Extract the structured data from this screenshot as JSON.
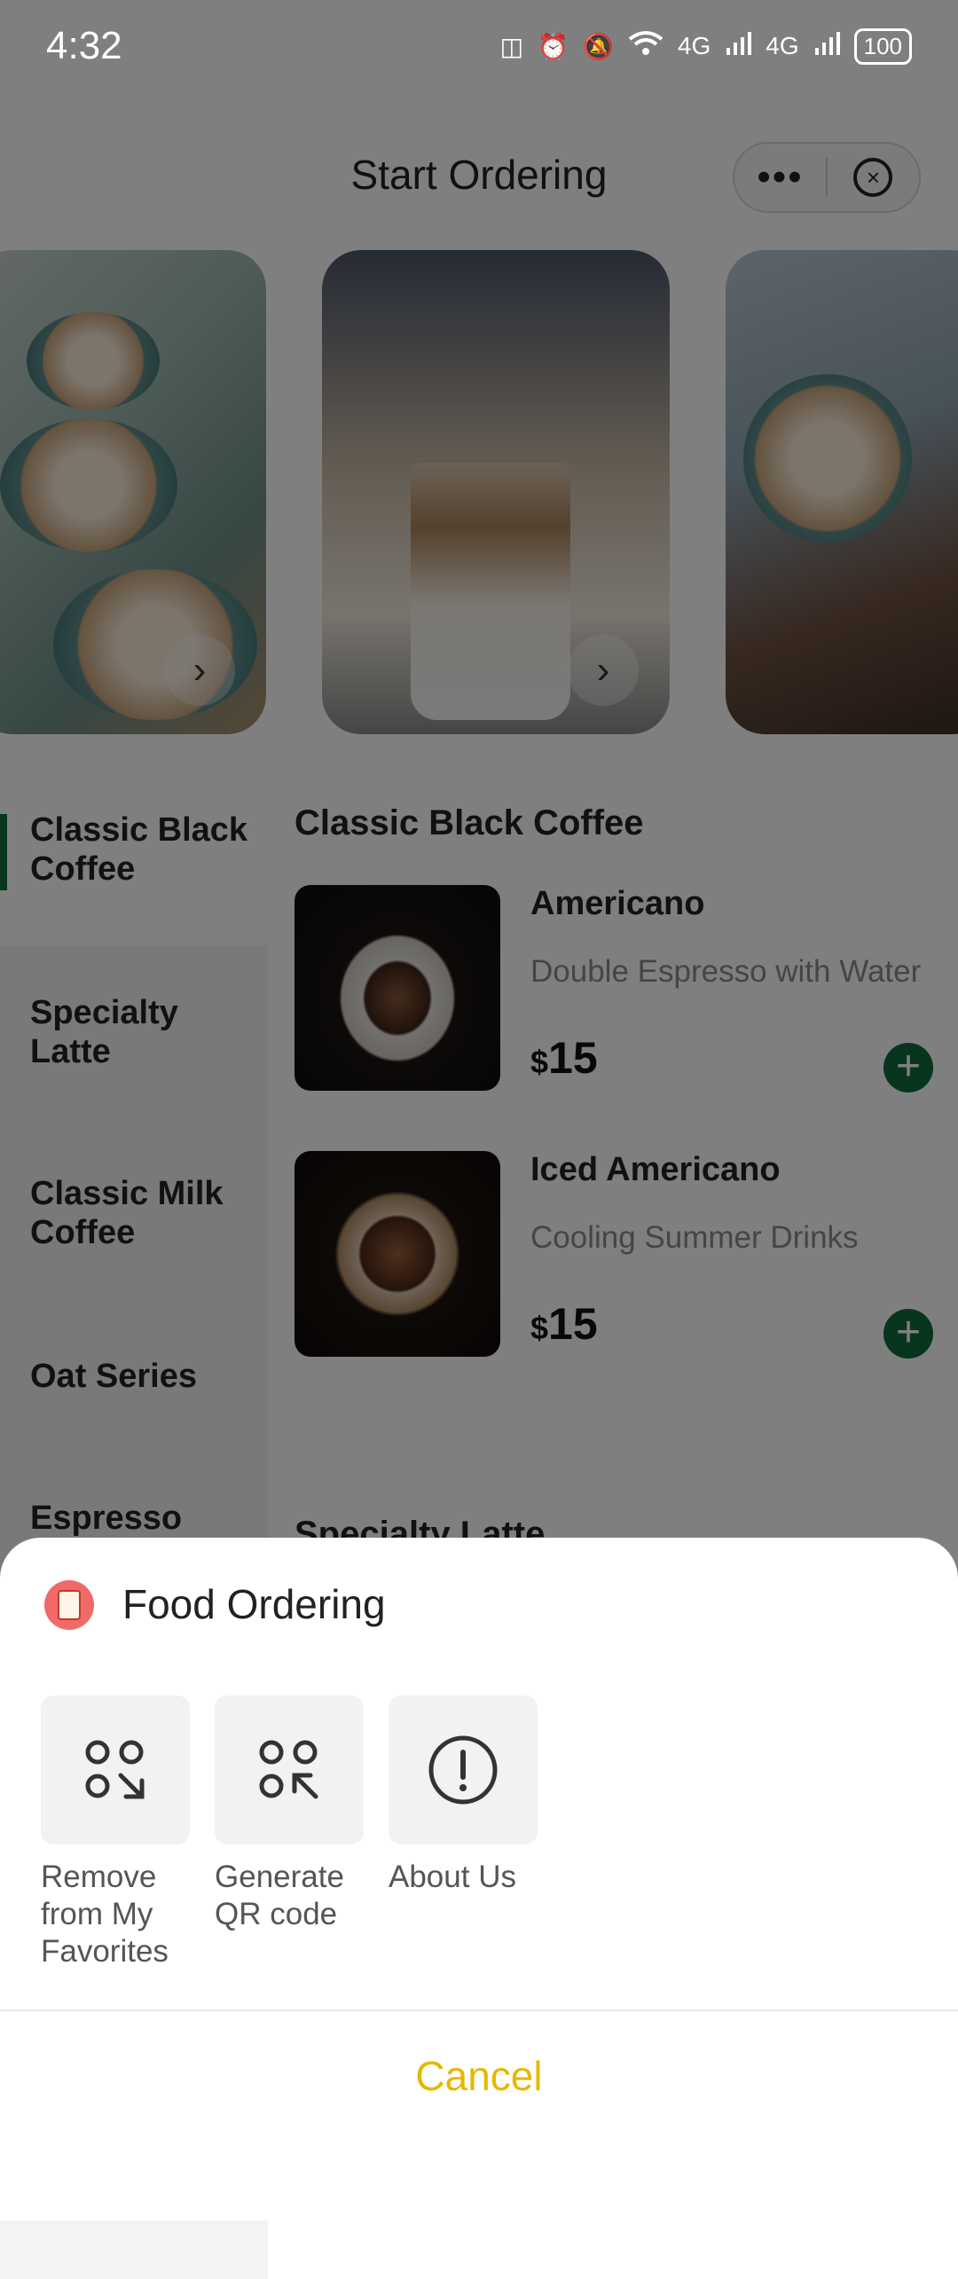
{
  "status_bar": {
    "time": "4:32",
    "battery": "100",
    "net1": "4G",
    "net2": "4G"
  },
  "header": {
    "title": "Start Ordering",
    "more_label": "•••",
    "close_label": "×"
  },
  "categories": [
    "Classic Black Coffee",
    "Specialty Latte",
    "Classic Milk Coffee",
    "Oat Series",
    "Espresso"
  ],
  "sections": [
    {
      "title": "Classic Black Coffee",
      "products": [
        {
          "name": "Americano",
          "desc": "Double Espresso with Water",
          "currency": "$",
          "price": "15"
        },
        {
          "name": "Iced Americano",
          "desc": "Cooling Summer Drinks",
          "currency": "$",
          "price": "15"
        }
      ]
    },
    {
      "title": "Specialty Latte"
    }
  ],
  "sheet": {
    "app_name": "Food Ordering",
    "actions": [
      {
        "label": "Remove from My Favorites",
        "icon": "remove-favorite-icon"
      },
      {
        "label": "Generate QR code",
        "icon": "qr-code-icon"
      },
      {
        "label": "About Us",
        "icon": "info-icon"
      }
    ],
    "cancel": "Cancel"
  },
  "colors": {
    "accent_green": "#0f6b3b",
    "cancel_yellow": "#e6b800"
  }
}
